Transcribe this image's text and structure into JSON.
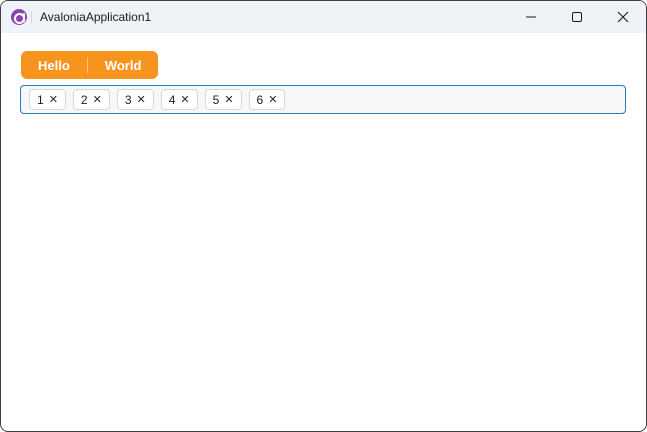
{
  "window": {
    "title": "AvaloniaApplication1",
    "icons": {
      "app_logo": "avalonia-logo",
      "minimize": "minimize-icon",
      "maximize": "maximize-icon",
      "close": "close-icon"
    }
  },
  "toolbar": {
    "split_button": {
      "segments": [
        {
          "label": "Hello"
        },
        {
          "label": "World"
        }
      ]
    }
  },
  "tags_field": {
    "remove_icon": "✕",
    "items": [
      {
        "label": "1"
      },
      {
        "label": "2"
      },
      {
        "label": "3"
      },
      {
        "label": "4"
      },
      {
        "label": "5"
      },
      {
        "label": "6"
      }
    ]
  },
  "colors": {
    "accent_orange": "#F7941E",
    "focus_border_blue": "#2D7AB5",
    "logo_purple": "#8B46AD",
    "titlebar_bg": "#EFF3F8",
    "window_border": "#3F3F3F"
  }
}
